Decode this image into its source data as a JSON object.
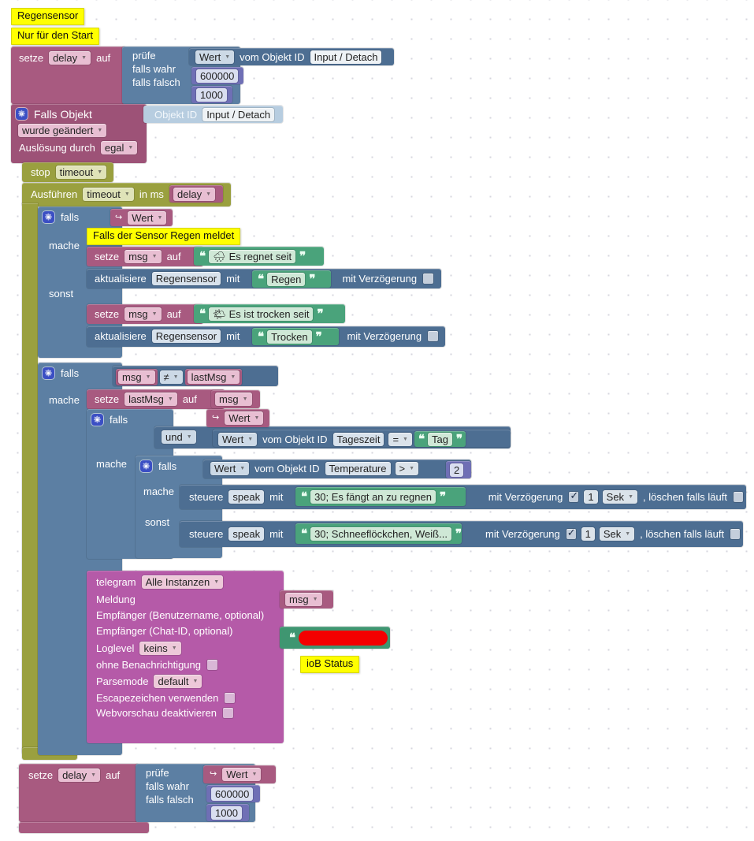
{
  "workspace": {
    "name": "blockly-workspace",
    "background": "#ffffff",
    "grid_dot_color": "#d6d6de"
  },
  "palette": {
    "variable_rose": "#a85a80",
    "timeout_olive": "#9aa03f",
    "control_blue": "#5c7fa3",
    "value_blue": "#4d6e92",
    "objectid_lightblue": "#b7cde0",
    "string_green": "#4aa37b",
    "telegram_magenta": "#b55aa8",
    "number_indigo": "#6f6fb5",
    "comment_yellow": "#ffff00",
    "redaction_red": "#f40000"
  },
  "comments": {
    "title": "Regensensor",
    "start_only": "Nur für den Start",
    "sensor_rain": "Falls der Sensor Regen meldet",
    "iob_status": "ioB Status"
  },
  "top_delay": {
    "setze": "setze",
    "variable": "delay",
    "auf": "auf",
    "pruefe": "prüfe",
    "falls_wahr": "falls wahr",
    "falls_falsch": "falls falsch",
    "value_wert": "Wert",
    "vom_objekt_id": "vom Objekt ID",
    "objekt_id": "Input / Detach",
    "true_value": "600000",
    "false_value": "1000"
  },
  "trigger": {
    "falls_objekt": "Falls Objekt",
    "objekt_id_label": "Objekt ID",
    "objekt_id_value": "Input / Detach",
    "change_mode": "wurde geändert",
    "ausloesung_label": "Auslösung durch",
    "ausloesung_value": "egal"
  },
  "timeout": {
    "stop": "stop",
    "stop_name": "timeout",
    "ausfuehren": "Ausführen",
    "exec_name": "timeout",
    "in_ms": "in  ms",
    "delay_var": "delay"
  },
  "if_wert": {
    "falls": "falls",
    "mache": "mache",
    "sonst": "sonst",
    "condition_var": "Wert",
    "condition_arrow": "↪"
  },
  "rain_branch": {
    "setze": "setze",
    "msg_var": "msg",
    "auf": "auf",
    "emoji": "🌧",
    "text": "Es regnet seit",
    "aktualisiere": "aktualisiere",
    "target": "Regensensor",
    "mit": "mit",
    "value": "Regen",
    "delay_label": "mit Verzögerung"
  },
  "dry_branch": {
    "setze": "setze",
    "msg_var": "msg",
    "auf": "auf",
    "emoji": "🌤",
    "text": "Es ist trocken seit",
    "aktualisiere": "aktualisiere",
    "target": "Regensensor",
    "mit": "mit",
    "value": "Trocken",
    "delay_label": "mit Verzögerung"
  },
  "if_changed": {
    "falls": "falls",
    "mache": "mache",
    "left_var": "msg",
    "operator": "≠",
    "right_var": "lastMsg",
    "setze": "setze",
    "assign_target": "lastMsg",
    "auf": "auf",
    "assign_value": "msg"
  },
  "if_and": {
    "falls": "falls",
    "mache": "mache",
    "arrow": "↪",
    "wert_var": "Wert",
    "und": "und",
    "obj_wert": "Wert",
    "vom_objekt_id": "vom Objekt ID",
    "obj_id": "Tageszeit",
    "operator": "=",
    "compare_text": "Tag"
  },
  "if_temp": {
    "falls": "falls",
    "mache": "mache",
    "sonst": "sonst",
    "obj_wert": "Wert",
    "vom_objekt_id": "vom Objekt ID",
    "obj_id": "Temperature",
    "operator": ">",
    "number": "2"
  },
  "speak_rain": {
    "steuere": "steuere",
    "target": "speak",
    "mit": "mit",
    "text": "30; Es fängt an zu regnen",
    "delay_label": "mit Verzögerung",
    "delay_checked": true,
    "delay_value": "1",
    "delay_unit": "Sek",
    "clear_label": ", löschen falls läuft",
    "clear_checked": false
  },
  "speak_snow": {
    "steuere": "steuere",
    "target": "speak",
    "mit": "mit",
    "text": "30; Schneeflöckchen, Weiß...",
    "delay_label": "mit Verzögerung",
    "delay_checked": true,
    "delay_value": "1",
    "delay_unit": "Sek",
    "clear_label": ", löschen falls läuft",
    "clear_checked": false
  },
  "telegram": {
    "title": "telegram",
    "instance": "Alle Instanzen",
    "meldung_label": "Meldung",
    "meldung_value": "msg",
    "user_label": "Empfänger (Benutzername, optional)",
    "chatid_label": "Empfänger (Chat-ID, optional)",
    "chatid_value": "",
    "loglevel_label": "Loglevel",
    "loglevel_value": "keins",
    "silent_label": "ohne Benachrichtigung",
    "silent_checked": false,
    "parsemode_label": "Parsemode",
    "parsemode_value": "default",
    "escape_label": "Escapezeichen verwenden",
    "escape_checked": false,
    "webpreview_label": "Webvorschau deaktivieren",
    "webpreview_checked": false
  },
  "bottom_delay": {
    "setze": "setze",
    "variable": "delay",
    "auf": "auf",
    "pruefe": "prüfe",
    "falls_wahr": "falls wahr",
    "falls_falsch": "falls falsch",
    "arrow": "↪",
    "value_wert": "Wert",
    "true_value": "600000",
    "false_value": "1000"
  }
}
